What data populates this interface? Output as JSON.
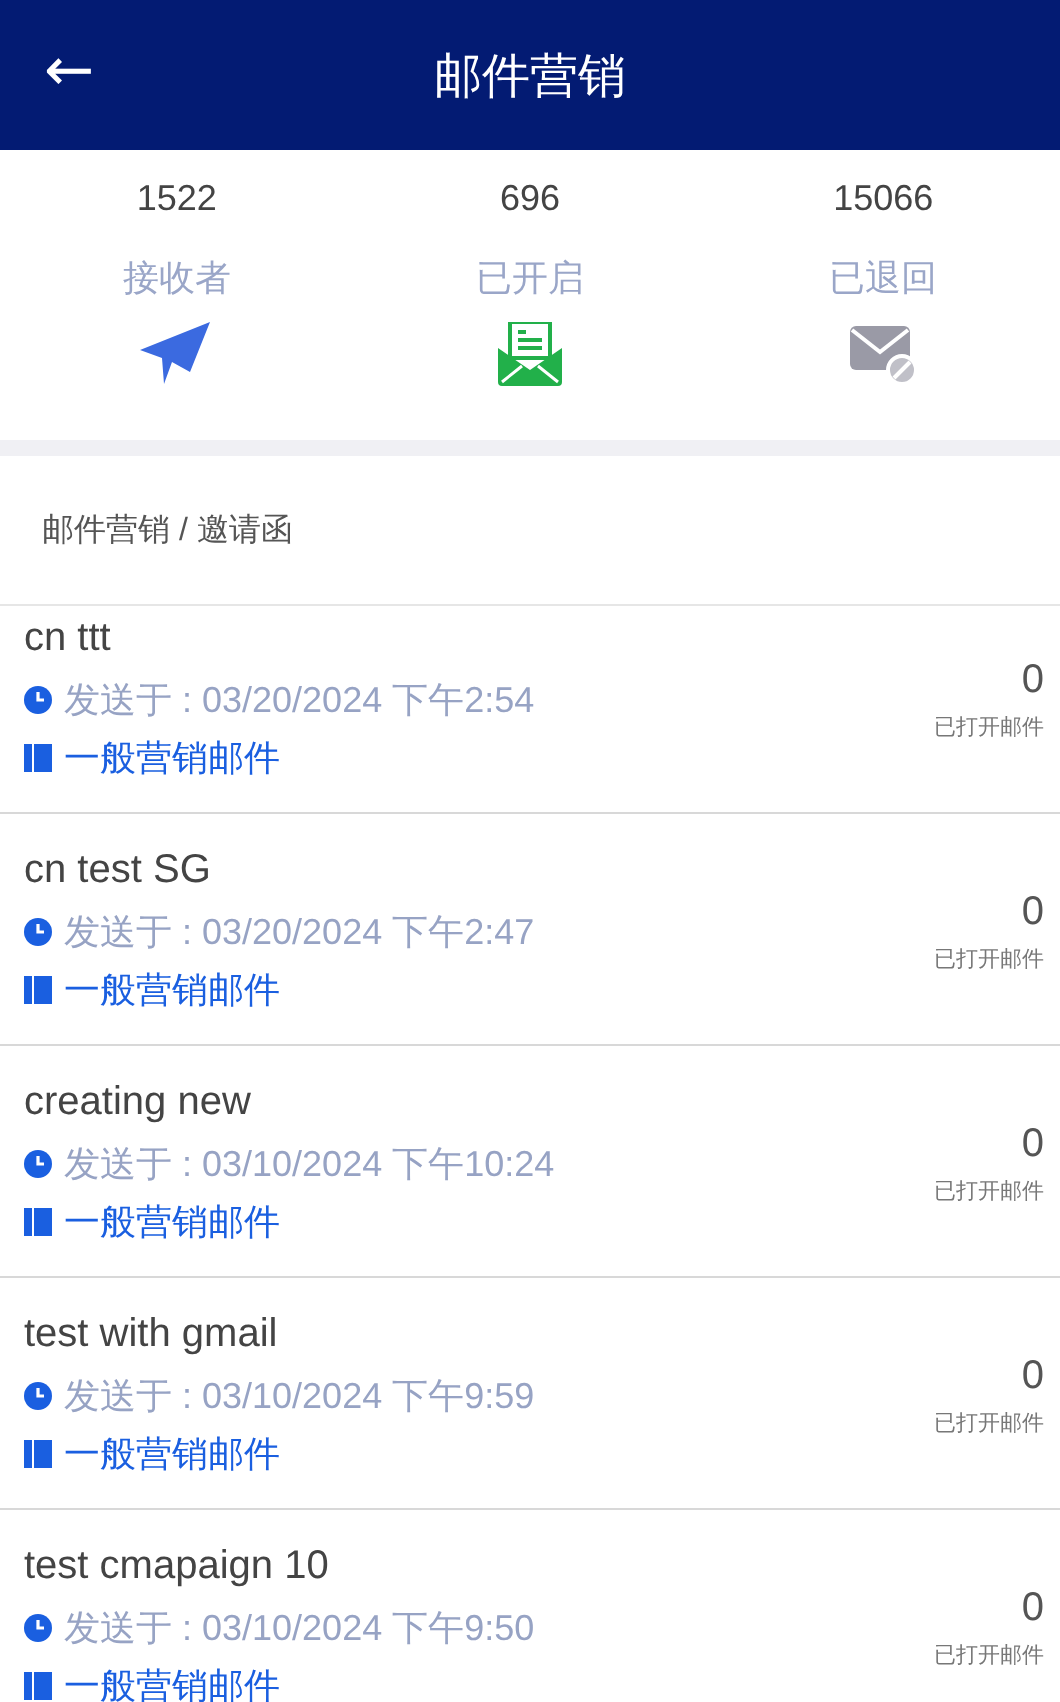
{
  "header": {
    "back": "←",
    "title": "邮件营销"
  },
  "stats": [
    {
      "kind": "sent",
      "value": "1522",
      "label": "接收者"
    },
    {
      "kind": "opened",
      "value": "696",
      "label": "已开启"
    },
    {
      "kind": "bounced",
      "value": "15066",
      "label": "已退回"
    }
  ],
  "breadcrumb": "邮件营销 / 邀请函",
  "campaigns": [
    {
      "title": "cn ttt",
      "sent": "发送于 : 03/20/2024 下午2:54",
      "type": "一般营销邮件",
      "opens": "0",
      "opens_label": "已打开邮件"
    },
    {
      "title": "cn test SG",
      "sent": "发送于 : 03/20/2024 下午2:47",
      "type": "一般营销邮件",
      "opens": "0",
      "opens_label": "已打开邮件"
    },
    {
      "title": "creating new",
      "sent": "发送于 : 03/10/2024 下午10:24",
      "type": "一般营销邮件",
      "opens": "0",
      "opens_label": "已打开邮件"
    },
    {
      "title": "test with gmail",
      "sent": "发送于 : 03/10/2024 下午9:59",
      "type": "一般营销邮件",
      "opens": "0",
      "opens_label": "已打开邮件"
    },
    {
      "title": "test cmapaign 10",
      "sent": "发送于 : 03/10/2024 下午9:50",
      "type": "一般营销邮件",
      "opens": "0",
      "opens_label": "已打开邮件"
    }
  ]
}
